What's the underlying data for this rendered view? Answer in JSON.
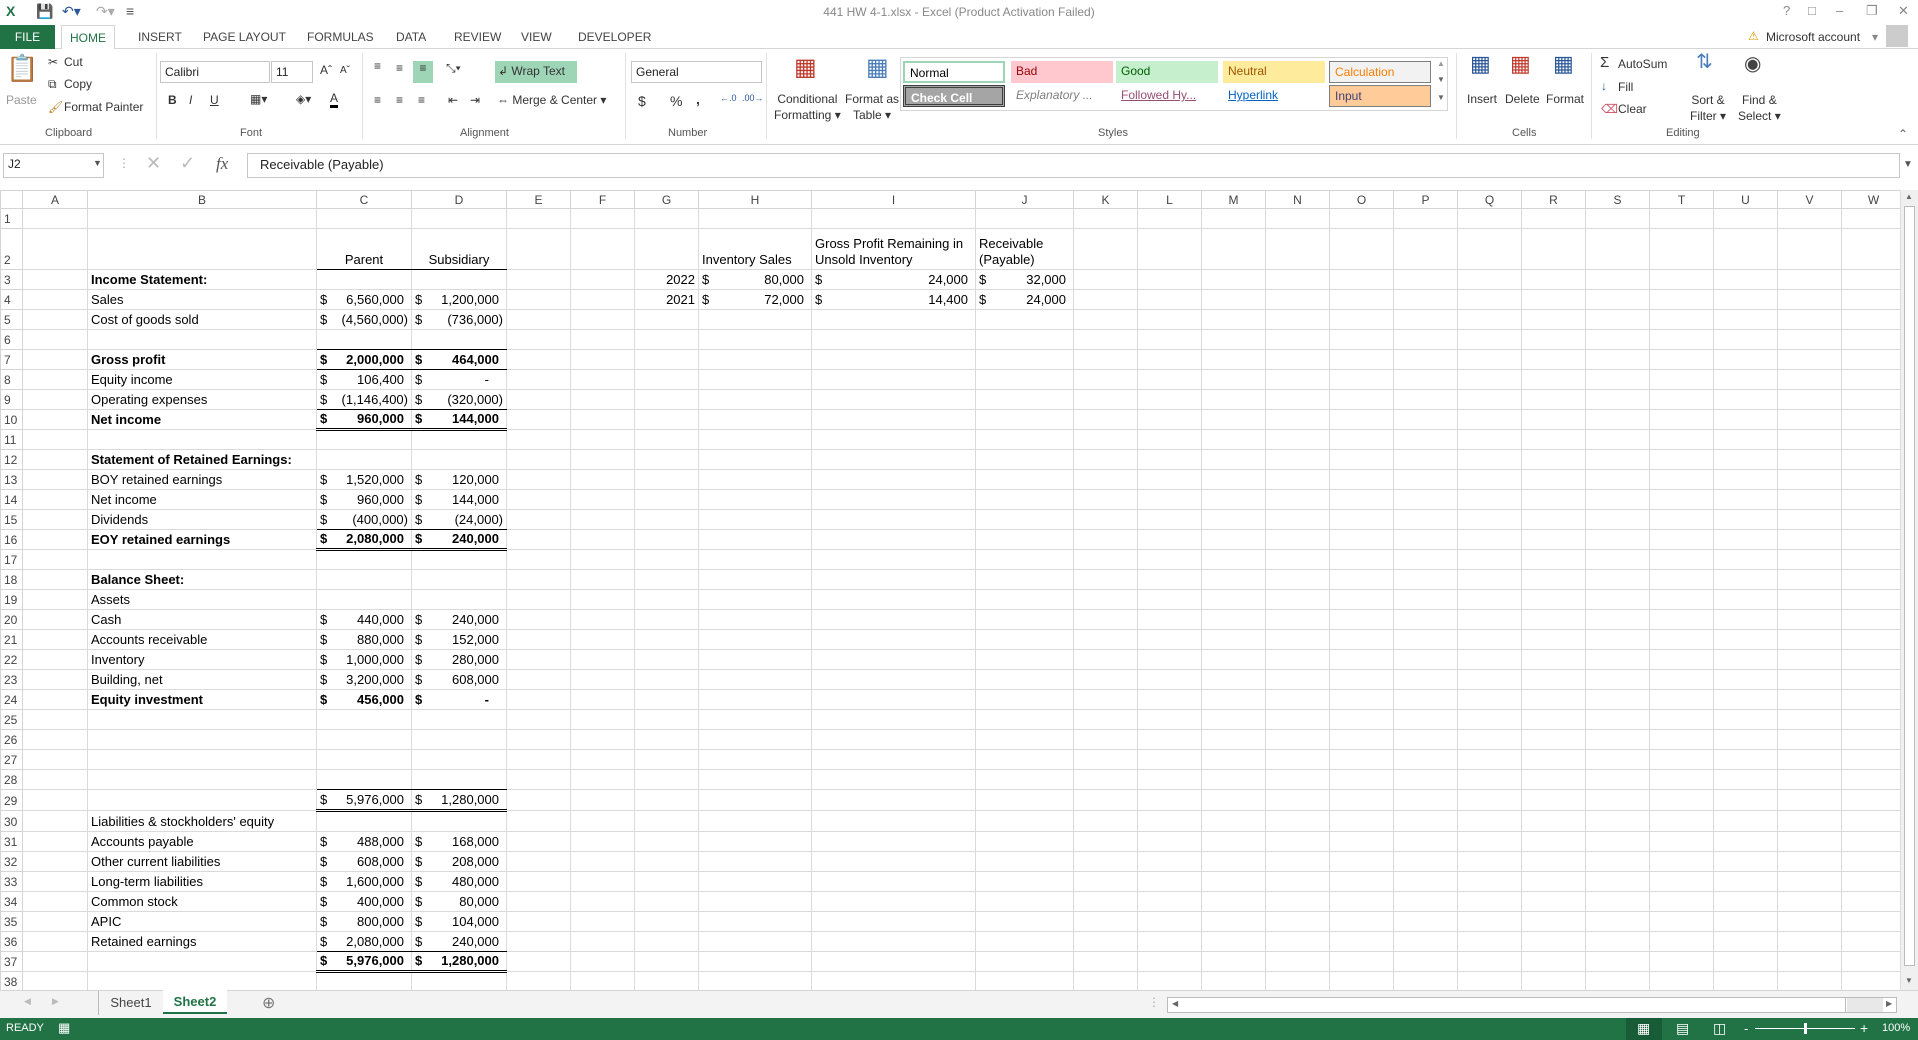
{
  "window": {
    "title": "441 HW 4-1.xlsx - Excel (Product Activation Failed)",
    "account": "Microsoft account",
    "help": "?"
  },
  "ribbon": {
    "tabs": [
      "FILE",
      "HOME",
      "INSERT",
      "PAGE LAYOUT",
      "FORMULAS",
      "DATA",
      "REVIEW",
      "VIEW",
      "DEVELOPER"
    ],
    "active_tab": "HOME",
    "clipboard": {
      "label": "Clipboard",
      "paste": "Paste",
      "cut": "Cut",
      "copy": "Copy",
      "format_painter": "Format Painter"
    },
    "font": {
      "label": "Font",
      "name": "Calibri",
      "size": "11",
      "bold": "B",
      "italic": "I",
      "underline": "U"
    },
    "alignment": {
      "label": "Alignment",
      "wrap_text": "Wrap Text",
      "merge_center": "Merge & Center"
    },
    "number": {
      "label": "Number",
      "format": "General",
      "currency": "$",
      "percent": "%",
      "comma": ","
    },
    "styles": {
      "label": "Styles",
      "conditional_formatting": [
        "Conditional",
        "Formatting"
      ],
      "format_as_table": [
        "Format as",
        "Table"
      ],
      "gallery": [
        {
          "name": "Normal",
          "bg": "#ffffff",
          "fg": "#000000"
        },
        {
          "name": "Bad",
          "bg": "#ffc7ce",
          "fg": "#9c0006"
        },
        {
          "name": "Good",
          "bg": "#c6efce",
          "fg": "#006100"
        },
        {
          "name": "Neutral",
          "bg": "#ffeb9c",
          "fg": "#9c5700"
        },
        {
          "name": "Calculation",
          "bg": "#f2f2f2",
          "fg": "#fa7d00"
        },
        {
          "name": "Check Cell",
          "bg": "#a5a5a5",
          "fg": "#ffffff"
        },
        {
          "name": "Explanatory ...",
          "bg": "#ffffff",
          "fg": "#7f7f7f"
        },
        {
          "name": "Followed Hy...",
          "bg": "#ffffff",
          "fg": "#954f72"
        },
        {
          "name": "Hyperlink",
          "bg": "#ffffff",
          "fg": "#0563c1"
        },
        {
          "name": "Input",
          "bg": "#ffcc99",
          "fg": "#3f3f76"
        }
      ]
    },
    "cells": {
      "label": "Cells",
      "insert": "Insert",
      "delete": "Delete",
      "format": "Format"
    },
    "editing": {
      "label": "Editing",
      "autosum": "AutoSum",
      "fill": "Fill",
      "clear": "Clear",
      "sort_filter": [
        "Sort &",
        "Filter"
      ],
      "find_select": [
        "Find &",
        "Select"
      ]
    }
  },
  "formula_bar": {
    "name_box": "J2",
    "formula": "Receivable (Payable)",
    "fx": "fx"
  },
  "sheet": {
    "columns": [
      "A",
      "B",
      "C",
      "D",
      "E",
      "F",
      "G",
      "H",
      "I",
      "J",
      "K",
      "L",
      "M",
      "N",
      "O",
      "P",
      "Q",
      "R",
      "S",
      "T",
      "U",
      "V",
      "W"
    ],
    "rows": [
      {
        "n": "1"
      },
      {
        "n": "2",
        "cells": {
          "C": "Parent",
          "D": "Subsidiary",
          "H": "Inventory Sales",
          "I": "Gross Profit Remaining in Unsold Inventory",
          "J": "Receivable (Payable)"
        }
      },
      {
        "n": "3",
        "cells": {
          "B": "Income Statement:",
          "G": "2022",
          "H": {
            "cur": "$",
            "v": "80,000"
          },
          "I": {
            "cur": "$",
            "v": "24,000"
          },
          "J": {
            "cur": "$",
            "v": "32,000"
          }
        }
      },
      {
        "n": "4",
        "cells": {
          "B": "Sales",
          "C": {
            "cur": "$",
            "v": "6,560,000"
          },
          "D": {
            "cur": "$",
            "v": "1,200,000"
          },
          "G": "2021",
          "H": {
            "cur": "$",
            "v": "72,000"
          },
          "I": {
            "cur": "$",
            "v": "14,400"
          },
          "J": {
            "cur": "$",
            "v": "24,000"
          }
        }
      },
      {
        "n": "5",
        "cells": {
          "B": "Cost of goods sold",
          "C": {
            "cur": "$",
            "v": "(4,560,000)"
          },
          "D": {
            "cur": "$",
            "v": "(736,000)"
          }
        }
      },
      {
        "n": "6"
      },
      {
        "n": "7",
        "cells": {
          "B": "Gross profit",
          "C": {
            "cur": "$",
            "v": "2,000,000"
          },
          "D": {
            "cur": "$",
            "v": "464,000"
          }
        }
      },
      {
        "n": "8",
        "cells": {
          "B": "Equity income",
          "C": {
            "cur": "$",
            "v": "106,400"
          },
          "D": {
            "cur": "$",
            "v": "-"
          }
        }
      },
      {
        "n": "9",
        "cells": {
          "B": "Operating expenses",
          "C": {
            "cur": "$",
            "v": "(1,146,400)"
          },
          "D": {
            "cur": "$",
            "v": "(320,000)"
          }
        }
      },
      {
        "n": "10",
        "cells": {
          "B": "Net income",
          "C": {
            "cur": "$",
            "v": "960,000"
          },
          "D": {
            "cur": "$",
            "v": "144,000"
          }
        }
      },
      {
        "n": "11"
      },
      {
        "n": "12",
        "cells": {
          "B": "Statement of Retained Earnings:"
        }
      },
      {
        "n": "13",
        "cells": {
          "B": "BOY retained earnings",
          "C": {
            "cur": "$",
            "v": "1,520,000"
          },
          "D": {
            "cur": "$",
            "v": "120,000"
          }
        }
      },
      {
        "n": "14",
        "cells": {
          "B": "Net income",
          "C": {
            "cur": "$",
            "v": "960,000"
          },
          "D": {
            "cur": "$",
            "v": "144,000"
          }
        }
      },
      {
        "n": "15",
        "cells": {
          "B": "Dividends",
          "C": {
            "cur": "$",
            "v": "(400,000)"
          },
          "D": {
            "cur": "$",
            "v": "(24,000)"
          }
        }
      },
      {
        "n": "16",
        "cells": {
          "B": "EOY retained earnings",
          "C": {
            "cur": "$",
            "v": "2,080,000"
          },
          "D": {
            "cur": "$",
            "v": "240,000"
          }
        }
      },
      {
        "n": "17"
      },
      {
        "n": "18",
        "cells": {
          "B": "Balance Sheet:"
        }
      },
      {
        "n": "19",
        "cells": {
          "B": "Assets"
        }
      },
      {
        "n": "20",
        "cells": {
          "B": "Cash",
          "C": {
            "cur": "$",
            "v": "440,000"
          },
          "D": {
            "cur": "$",
            "v": "240,000"
          }
        }
      },
      {
        "n": "21",
        "cells": {
          "B": "Accounts receivable",
          "C": {
            "cur": "$",
            "v": "880,000"
          },
          "D": {
            "cur": "$",
            "v": "152,000"
          }
        }
      },
      {
        "n": "22",
        "cells": {
          "B": "Inventory",
          "C": {
            "cur": "$",
            "v": "1,000,000"
          },
          "D": {
            "cur": "$",
            "v": "280,000"
          }
        }
      },
      {
        "n": "23",
        "cells": {
          "B": "Building, net",
          "C": {
            "cur": "$",
            "v": "3,200,000"
          },
          "D": {
            "cur": "$",
            "v": "608,000"
          }
        }
      },
      {
        "n": "24",
        "cells": {
          "B": "Equity investment",
          "C": {
            "cur": "$",
            "v": "456,000"
          },
          "D": {
            "cur": "$",
            "v": "-"
          }
        }
      },
      {
        "n": "25"
      },
      {
        "n": "26"
      },
      {
        "n": "27"
      },
      {
        "n": "28"
      },
      {
        "n": "29",
        "cells": {
          "C": {
            "cur": "$",
            "v": "5,976,000"
          },
          "D": {
            "cur": "$",
            "v": "1,280,000"
          }
        }
      },
      {
        "n": "30",
        "cells": {
          "B": "Liabilities & stockholders' equity"
        }
      },
      {
        "n": "31",
        "cells": {
          "B": "Accounts payable",
          "C": {
            "cur": "$",
            "v": "488,000"
          },
          "D": {
            "cur": "$",
            "v": "168,000"
          }
        }
      },
      {
        "n": "32",
        "cells": {
          "B": "Other current liabilities",
          "C": {
            "cur": "$",
            "v": "608,000"
          },
          "D": {
            "cur": "$",
            "v": "208,000"
          }
        }
      },
      {
        "n": "33",
        "cells": {
          "B": "Long-term liabilities",
          "C": {
            "cur": "$",
            "v": "1,600,000"
          },
          "D": {
            "cur": "$",
            "v": "480,000"
          }
        }
      },
      {
        "n": "34",
        "cells": {
          "B": "Common stock",
          "C": {
            "cur": "$",
            "v": "400,000"
          },
          "D": {
            "cur": "$",
            "v": "80,000"
          }
        }
      },
      {
        "n": "35",
        "cells": {
          "B": "APIC",
          "C": {
            "cur": "$",
            "v": "800,000"
          },
          "D": {
            "cur": "$",
            "v": "104,000"
          }
        }
      },
      {
        "n": "36",
        "cells": {
          "B": "Retained earnings",
          "C": {
            "cur": "$",
            "v": "2,080,000"
          },
          "D": {
            "cur": "$",
            "v": "240,000"
          }
        }
      },
      {
        "n": "37",
        "cells": {
          "C": {
            "cur": "$",
            "v": "5,976,000"
          },
          "D": {
            "cur": "$",
            "v": "1,280,000"
          }
        }
      },
      {
        "n": "38"
      }
    ]
  },
  "sheet_tabs": {
    "tabs": [
      "Sheet1",
      "Sheet2"
    ],
    "active": "Sheet2"
  },
  "status_bar": {
    "mode": "READY",
    "zoom": "100%",
    "zoom_min": "-",
    "zoom_max": "+"
  },
  "colors": {
    "excel_green": "#217346",
    "wrap_text_active": "#9fd5b7"
  }
}
